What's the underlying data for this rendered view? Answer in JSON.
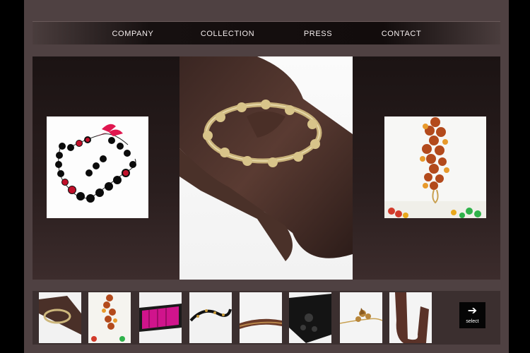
{
  "nav": {
    "items": [
      {
        "label": "COMPANY"
      },
      {
        "label": "COLLECTION"
      },
      {
        "label": "PRESS"
      },
      {
        "label": "CONTACT"
      }
    ]
  },
  "gallery": {
    "featured": {
      "subject": "leather belt with gold chain buckle"
    },
    "left": {
      "subject": "black bead necklace with pink ribbon"
    },
    "right": {
      "subject": "amber beaded bracelet"
    },
    "thumbnails": [
      {
        "subject": "leather belt with gold chain"
      },
      {
        "subject": "amber beaded bracelet"
      },
      {
        "subject": "pink ribbon belt"
      },
      {
        "subject": "black beaded bracelet"
      },
      {
        "subject": "braided bronze bracelet"
      },
      {
        "subject": "black jeweled belt"
      },
      {
        "subject": "floral brooch chain"
      },
      {
        "subject": "brown leather strap"
      }
    ],
    "next_button": {
      "label": "select",
      "icon": "arrow-right-icon"
    }
  },
  "colors": {
    "page": "#4f4142",
    "nav": "#161010",
    "stage": "#1b1313",
    "strip": "#3b2f2f"
  }
}
